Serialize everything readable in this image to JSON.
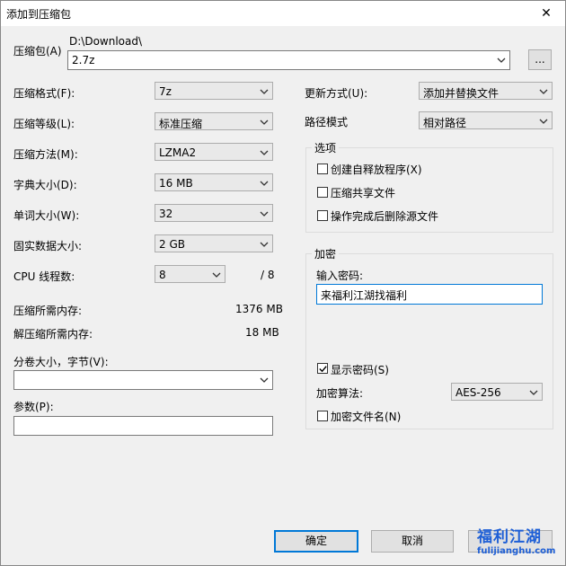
{
  "window": {
    "title": "添加到压缩包",
    "close_glyph": "✕"
  },
  "archive": {
    "label": "压缩包(A)",
    "path": "D:\\Download\\",
    "name": "2.7z",
    "browse_label": "..."
  },
  "left": {
    "format_label": "压缩格式(F):",
    "format_value": "7z",
    "level_label": "压缩等级(L):",
    "level_value": "标准压缩",
    "method_label": "压缩方法(M):",
    "method_value": "LZMA2",
    "dict_label": "字典大小(D):",
    "dict_value": "16 MB",
    "word_label": "单词大小(W):",
    "word_value": "32",
    "solid_label": "固实数据大小:",
    "solid_value": "2 GB",
    "threads_label": "CPU 线程数:",
    "threads_value": "8",
    "threads_max": "/ 8",
    "mem_compress_label": "压缩所需内存:",
    "mem_compress_value": "1376 MB",
    "mem_decompress_label": "解压缩所需内存:",
    "mem_decompress_value": "18 MB",
    "split_label": "分卷大小，字节(V):",
    "split_value": "",
    "params_label": "参数(P):",
    "params_value": ""
  },
  "right": {
    "update_label": "更新方式(U):",
    "update_value": "添加并替换文件",
    "pathmode_label": "路径模式",
    "pathmode_value": "相对路径",
    "options_title": "选项",
    "opt_sfx": "创建自释放程序(X)",
    "opt_shared": "压缩共享文件",
    "opt_delete": "操作完成后删除源文件",
    "encrypt_title": "加密",
    "password_label": "输入密码:",
    "password_value": "来福利江湖找福利",
    "show_password": "显示密码(S)",
    "enc_method_label": "加密算法:",
    "enc_method_value": "AES-256",
    "enc_names": "加密文件名(N)"
  },
  "buttons": {
    "ok": "确定",
    "cancel": "取消"
  },
  "watermark": {
    "brand": "福利江湖",
    "url": "fulijianghu.com"
  }
}
